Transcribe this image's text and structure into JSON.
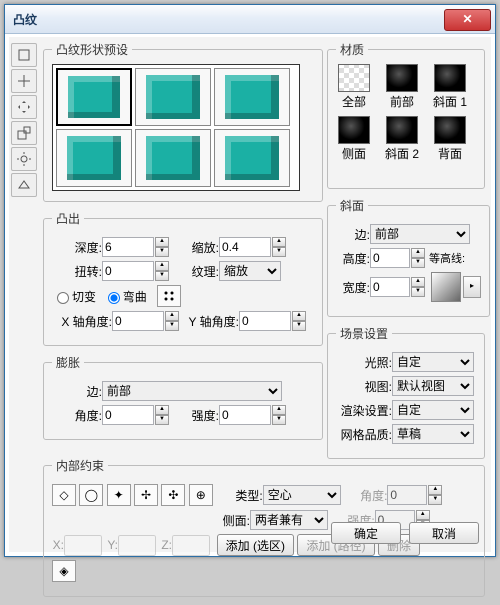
{
  "title": "凸纹",
  "groups": {
    "preset": "凸纹形状预设",
    "extrude": "凸出",
    "inflate": "膨胀",
    "internal": "内部约束",
    "material": "材质",
    "bevel": "斜面",
    "scene": "场景设置"
  },
  "extrude": {
    "depth_lbl": "深度:",
    "depth": "6",
    "scale_lbl": "缩放:",
    "scale": "0.4",
    "twist_lbl": "扭转:",
    "twist": "0",
    "texture_lbl": "纹理:",
    "texture": "缩放",
    "shear_lbl": "切变",
    "bend_lbl": "弯曲",
    "x_lbl": "X 轴角度:",
    "x": "0",
    "y_lbl": "Y 轴角度:",
    "y": "0"
  },
  "inflate": {
    "edge_lbl": "边:",
    "edge": "前部",
    "angle_lbl": "角度:",
    "angle": "0",
    "strength_lbl": "强度:",
    "strength": "0"
  },
  "material": {
    "all": "全部",
    "front": "前部",
    "bevel1": "斜面 1",
    "side": "侧面",
    "bevel2": "斜面 2",
    "back": "背面"
  },
  "bevel": {
    "edge_lbl": "边:",
    "edge": "前部",
    "height_lbl": "高度:",
    "height": "0",
    "contour_lbl": "等高线:",
    "width_lbl": "宽度:",
    "width": "0"
  },
  "scene": {
    "light_lbl": "光照:",
    "light": "自定",
    "view_lbl": "视图:",
    "view": "默认视图",
    "render_lbl": "渲染设置:",
    "render": "自定",
    "mesh_lbl": "网格品质:",
    "mesh": "草稿"
  },
  "internal": {
    "type_lbl": "类型:",
    "type": "空心",
    "side_lbl": "侧面:",
    "side": "两者兼有",
    "angle_lbl": "角度:",
    "angle": "0",
    "strength_lbl": "强度:",
    "strength": "0",
    "x_lbl": "X:",
    "y_lbl": "Y:",
    "z_lbl": "Z:",
    "addsel_lbl": "添加 (选区)",
    "addpath_lbl": "添加 (路径)",
    "del_lbl": "删除"
  },
  "footer": {
    "ok": "确定",
    "cancel": "取消"
  }
}
